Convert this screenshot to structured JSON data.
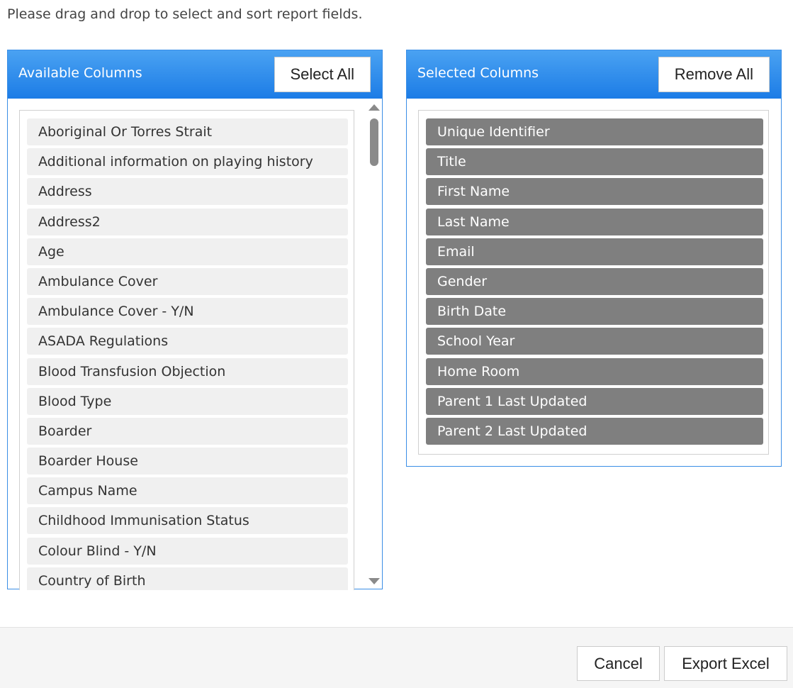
{
  "instructions": "Please drag and drop to select and sort report fields.",
  "available": {
    "title": "Available Columns",
    "select_all_label": "Select All",
    "items": [
      "Aboriginal Or Torres Strait",
      "Additional information on playing history",
      "Address",
      "Address2",
      "Age",
      "Ambulance Cover",
      "Ambulance Cover - Y/N",
      "ASADA Regulations",
      "Blood Transfusion Objection",
      "Blood Type",
      "Boarder",
      "Boarder House",
      "Campus Name",
      "Childhood Immunisation Status",
      "Colour Blind - Y/N",
      "Country of Birth"
    ]
  },
  "selected": {
    "title": "Selected Columns",
    "remove_all_label": "Remove All",
    "items": [
      "Unique Identifier",
      "Title",
      "First Name",
      "Last Name",
      "Email",
      "Gender",
      "Birth Date",
      "School Year",
      "Home Room",
      "Parent 1 Last Updated",
      "Parent 2 Last Updated"
    ]
  },
  "footer": {
    "cancel_label": "Cancel",
    "export_label": "Export Excel"
  },
  "colors": {
    "header_accent": "#1c7ce6",
    "selected_item_bg": "#7f7f7f",
    "available_item_bg": "#f0f0f0"
  }
}
